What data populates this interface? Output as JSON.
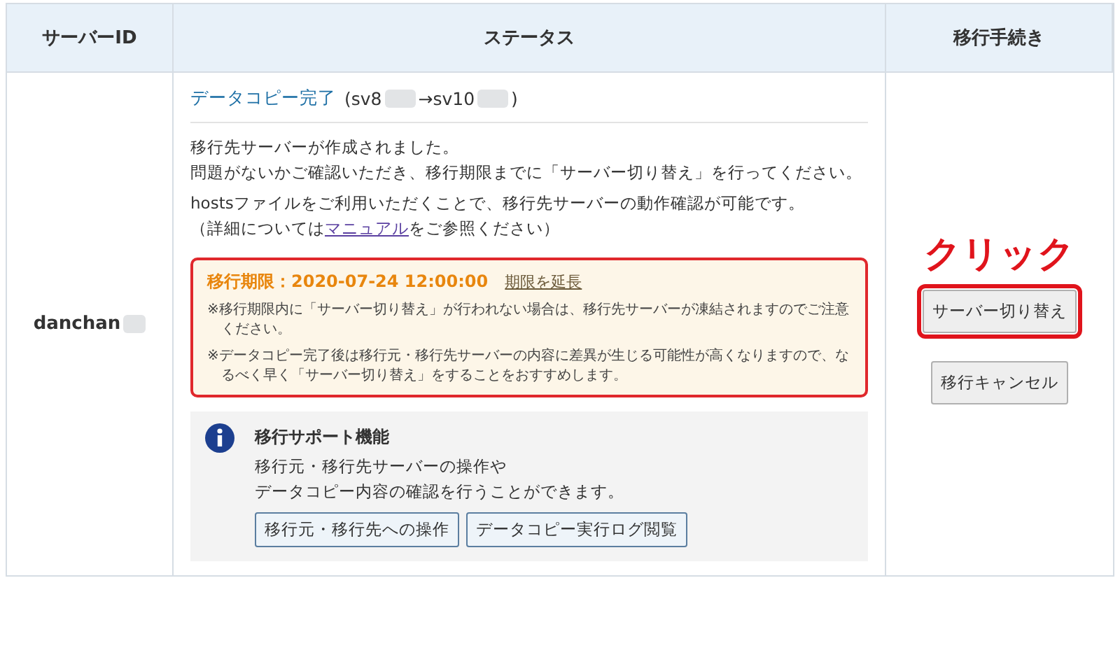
{
  "table": {
    "columns": [
      "サーバーID",
      "ステータス",
      "移行手続き"
    ],
    "rows": [
      {
        "server_id": "danchan",
        "server_id_redacted": true,
        "status": {
          "title": "データコピー完了",
          "route_parts": [
            "(sv8",
            "→sv10",
            ")"
          ],
          "message": [
            "移行先サーバーが作成されました。",
            "問題がないかご確認いただき、移行期限までに「サーバー切り替え」を行ってください。"
          ],
          "hosts_note": "hostsファイルをご利用いただくことで、移行先サーバーの動作確認が可能です。",
          "detail_note": {
            "before": "（詳細については",
            "link": "マニュアル",
            "after": "をご参照ください）"
          },
          "deadline": {
            "label": "移行期限：2020-07-24 12:00:00",
            "link": "期限を延長",
            "notes": [
              "※移行期限内に「サーバー切り替え」が行われない場合は、移行先サーバーが凍結されますのでご注意ください。",
              "※データコピー完了後は移行元・移行先サーバーの内容に差異が生じる可能性が高くなりますので、なるべく早く「サーバー切り替え」をすることをおすすめします。"
            ]
          },
          "support": {
            "title": "移行サポート機能",
            "text": [
              "移行元・移行先サーバーの操作や",
              "データコピー内容の確認を行うことができます。"
            ],
            "buttons": [
              "移行元・移行先への操作",
              "データコピー実行ログ閲覧"
            ]
          }
        },
        "actions": {
          "callout": "クリック",
          "buttons": [
            {
              "label": "サーバー切り替え",
              "highlighted": true
            },
            {
              "label": "移行キャンセル",
              "highlighted": false
            }
          ]
        }
      }
    ]
  }
}
